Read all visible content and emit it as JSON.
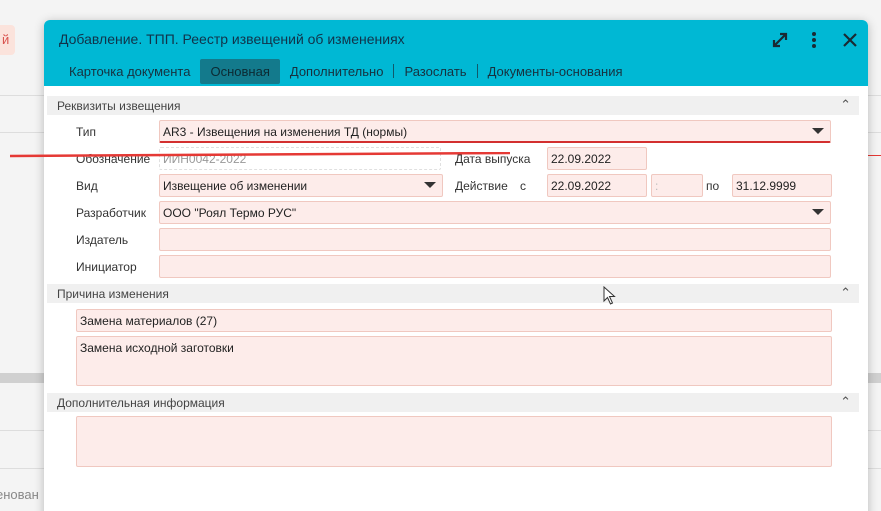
{
  "background": {
    "left_button_glyph": "й",
    "bottom_text": "енован"
  },
  "dialog": {
    "title": "Добавление. ТПП. Реестр извещений об изменениях",
    "tabs": [
      {
        "label": "Карточка документа"
      },
      {
        "label": "Основная"
      },
      {
        "label": "Дополнительно"
      },
      {
        "label": "Разослать"
      },
      {
        "label": "Документы-основания"
      }
    ],
    "active_tab": "Основная"
  },
  "sections": {
    "requisites": {
      "title": "Реквизиты извещения",
      "fields": {
        "type_label": "Тип",
        "type_value": "AR3 - Извещения на изменения ТД (нормы)",
        "designation_label": "Обозначение",
        "designation_value": "ИИН0042-2022",
        "release_date_label": "Дата выпуска",
        "release_date_value": "22.09.2022",
        "kind_label": "Вид",
        "kind_value": "Извещение об изменении",
        "action_label": "Действие",
        "action_from_label": "с",
        "action_from_value": "22.09.2022",
        "action_time_value": ":",
        "action_to_label": "по",
        "action_to_value": "31.12.9999",
        "developer_label": "Разработчик",
        "developer_value": "ООО \"Роял Термо РУС\"",
        "publisher_label": "Издатель",
        "publisher_value": "",
        "initiator_label": "Инициатор",
        "initiator_value": ""
      }
    },
    "reason": {
      "title": "Причина изменения",
      "reason_value": "Замена материалов (27)",
      "reason_detail": "Замена исходной заготовки"
    },
    "additional": {
      "title": "Дополнительная информация",
      "value": ""
    }
  },
  "colors": {
    "header": "#00b8d4",
    "active_tab": "#137a8c",
    "field_bg": "#fdecea",
    "annotation_red": "#e53935"
  }
}
